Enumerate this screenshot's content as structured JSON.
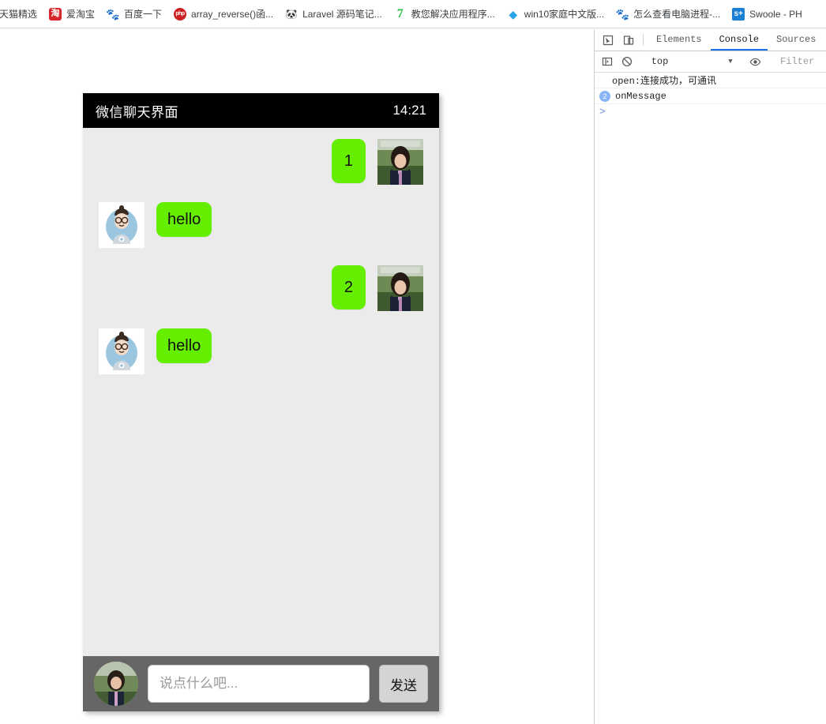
{
  "bookmarks": [
    {
      "label": "天猫精选",
      "icon": "tmall-icon",
      "glyph": "猫",
      "cls": "ico-tmall"
    },
    {
      "label": "爱淘宝",
      "icon": "taobao-icon",
      "glyph": "淘",
      "cls": "ico-taobao"
    },
    {
      "label": "百度一下",
      "icon": "baidu-icon",
      "glyph": "🐾",
      "cls": "ico-baidu"
    },
    {
      "label": "array_reverse()函...",
      "icon": "php-icon",
      "glyph": "php",
      "cls": "ico-php"
    },
    {
      "label": "Laravel 源码笔记...",
      "icon": "laravel-icon",
      "glyph": "🐼",
      "cls": "ico-laravel"
    },
    {
      "label": "教您解决应用程序...",
      "icon": "seven-icon",
      "glyph": "7",
      "cls": "ico-seven"
    },
    {
      "label": "win10家庭中文版...",
      "icon": "windows-icon",
      "glyph": "◆",
      "cls": "ico-win"
    },
    {
      "label": "怎么查看电脑进程-...",
      "icon": "baidu-icon",
      "glyph": "🐾",
      "cls": "ico-baidu"
    },
    {
      "label": "Swoole - PH",
      "icon": "swoole-icon",
      "glyph": "s+",
      "cls": "ico-swoole"
    }
  ],
  "chat": {
    "header": {
      "title": "微信聊天界面",
      "time": "14:21"
    },
    "messages": [
      {
        "side": "outgoing",
        "text": "1",
        "avatar": "girl-photo-avatar"
      },
      {
        "side": "incoming",
        "text": "hello",
        "avatar": "cartoon-man-avatar"
      },
      {
        "side": "outgoing",
        "text": "2",
        "avatar": "girl-photo-avatar"
      },
      {
        "side": "incoming",
        "text": "hello",
        "avatar": "cartoon-man-avatar"
      }
    ],
    "footer": {
      "input_value": "",
      "input_placeholder": "说点什么吧...",
      "send_label": "发送"
    },
    "colors": {
      "bubble_green": "#66ee00",
      "header_black": "#000000",
      "body_gray": "#ebebeb",
      "footer_gray": "#666666"
    }
  },
  "devtools": {
    "tabs": [
      {
        "label": "Elements",
        "active": false
      },
      {
        "label": "Console",
        "active": true
      },
      {
        "label": "Sources",
        "active": false
      }
    ],
    "filterbar": {
      "context": "top",
      "filter_placeholder": "Filter"
    },
    "console_rows": [
      {
        "count": "",
        "text": "open:连接成功，可通讯",
        "indent": true
      },
      {
        "count": "2",
        "text": "onMessage",
        "indent": false
      }
    ],
    "prompt": ">",
    "accent": "#1a73e8"
  }
}
